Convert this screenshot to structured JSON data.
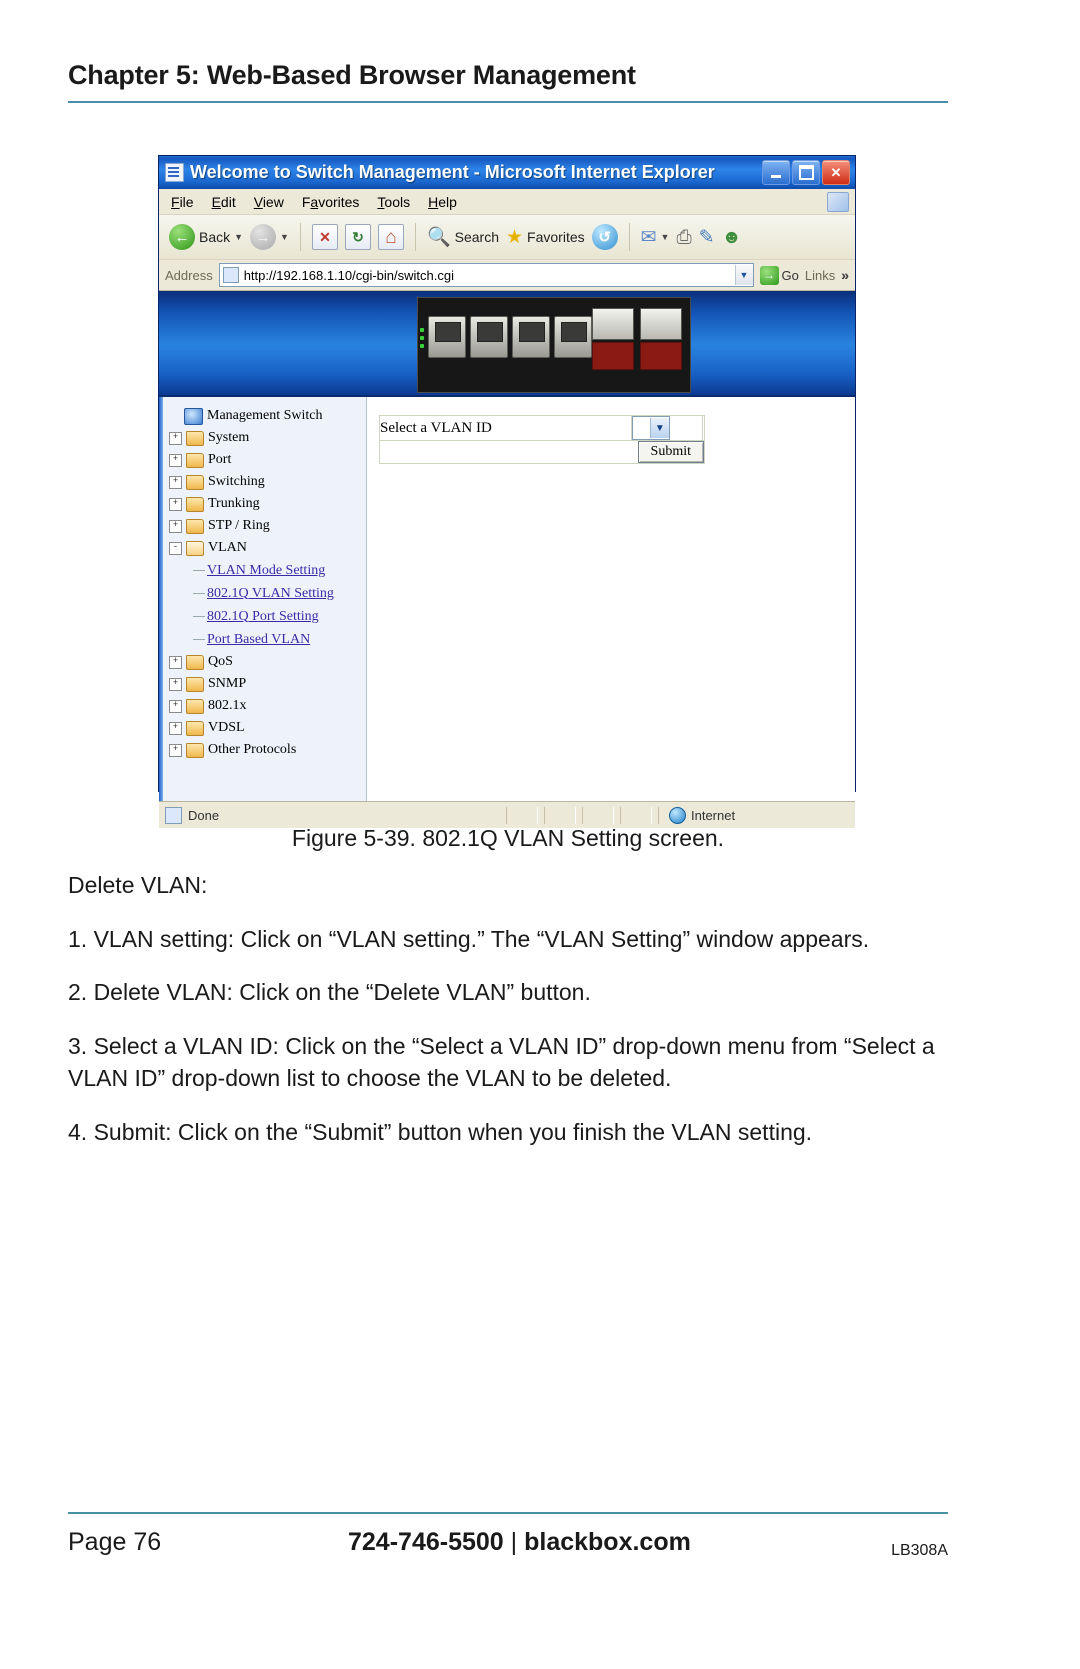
{
  "page": {
    "chapter_title": "Chapter 5: Web-Based Browser Management",
    "figure_caption": "Figure 5-39. 802.1Q VLAN Setting screen.",
    "footer": {
      "page_label": "Page 76",
      "phone": "724-746-5500",
      "separator": "|",
      "site": "blackbox.com",
      "model": "LB308A"
    },
    "paragraphs": [
      "Delete VLAN:",
      "1. VLAN setting: Click on “VLAN setting.” The “VLAN Setting” window appears.",
      "2. Delete VLAN: Click on the “Delete VLAN” button.",
      "3. Select a VLAN ID: Click on the “Select a VLAN ID” drop-down menu from “Select a VLAN ID” drop-down list to choose the VLAN to be deleted.",
      "4. Submit: Click on the “Submit” button when you finish the VLAN setting."
    ]
  },
  "browser": {
    "title": "Welcome to Switch Management - Microsoft Internet Explorer",
    "window_buttons": {
      "minimize": "_",
      "maximize": "□",
      "close": "✕"
    },
    "menu": [
      "File",
      "Edit",
      "View",
      "Favorites",
      "Tools",
      "Help"
    ],
    "toolbar": {
      "back_label": "Back",
      "forward_label": "",
      "stop_label": "✕",
      "refresh_label": "↻",
      "home_label": "⌂",
      "search_label": "Search",
      "favorites_label": "Favorites",
      "history_label": "↺",
      "mail_label": "✉",
      "print_label": "⎙",
      "edit_label": "✎",
      "messenger_label": "☻"
    },
    "address": {
      "label": "Address",
      "url": "http://192.168.1.10/cgi-bin/switch.cgi",
      "go_label": "Go",
      "links_label": "Links",
      "chevron": "»"
    },
    "statusbar": {
      "status": "Done",
      "zone": "Internet"
    }
  },
  "tree": {
    "root": "Management Switch",
    "nodes": [
      {
        "label": "System",
        "expander": "+"
      },
      {
        "label": "Port",
        "expander": "+"
      },
      {
        "label": "Switching",
        "expander": "+"
      },
      {
        "label": "Trunking",
        "expander": "+"
      },
      {
        "label": "STP / Ring",
        "expander": "+"
      },
      {
        "label": "VLAN",
        "expander": "-"
      }
    ],
    "vlan_children": [
      "VLAN Mode Setting",
      "802.1Q VLAN Setting",
      "802.1Q Port Setting",
      "Port Based VLAN"
    ],
    "nodes_after": [
      {
        "label": "QoS",
        "expander": "+"
      },
      {
        "label": "SNMP",
        "expander": "+"
      },
      {
        "label": "802.1x",
        "expander": "+"
      },
      {
        "label": "VDSL",
        "expander": "+"
      },
      {
        "label": "Other Protocols",
        "expander": "+"
      }
    ]
  },
  "form": {
    "vlan_id_label": "Select a VLAN ID",
    "vlan_id_value": "",
    "dropdown_arrow": "⌄",
    "submit_label": "Submit"
  },
  "colors": {
    "rule": "#4a8fa8",
    "titlebar": "#1558c0",
    "link": "#3b2aa8",
    "banner": "#1356b8"
  }
}
